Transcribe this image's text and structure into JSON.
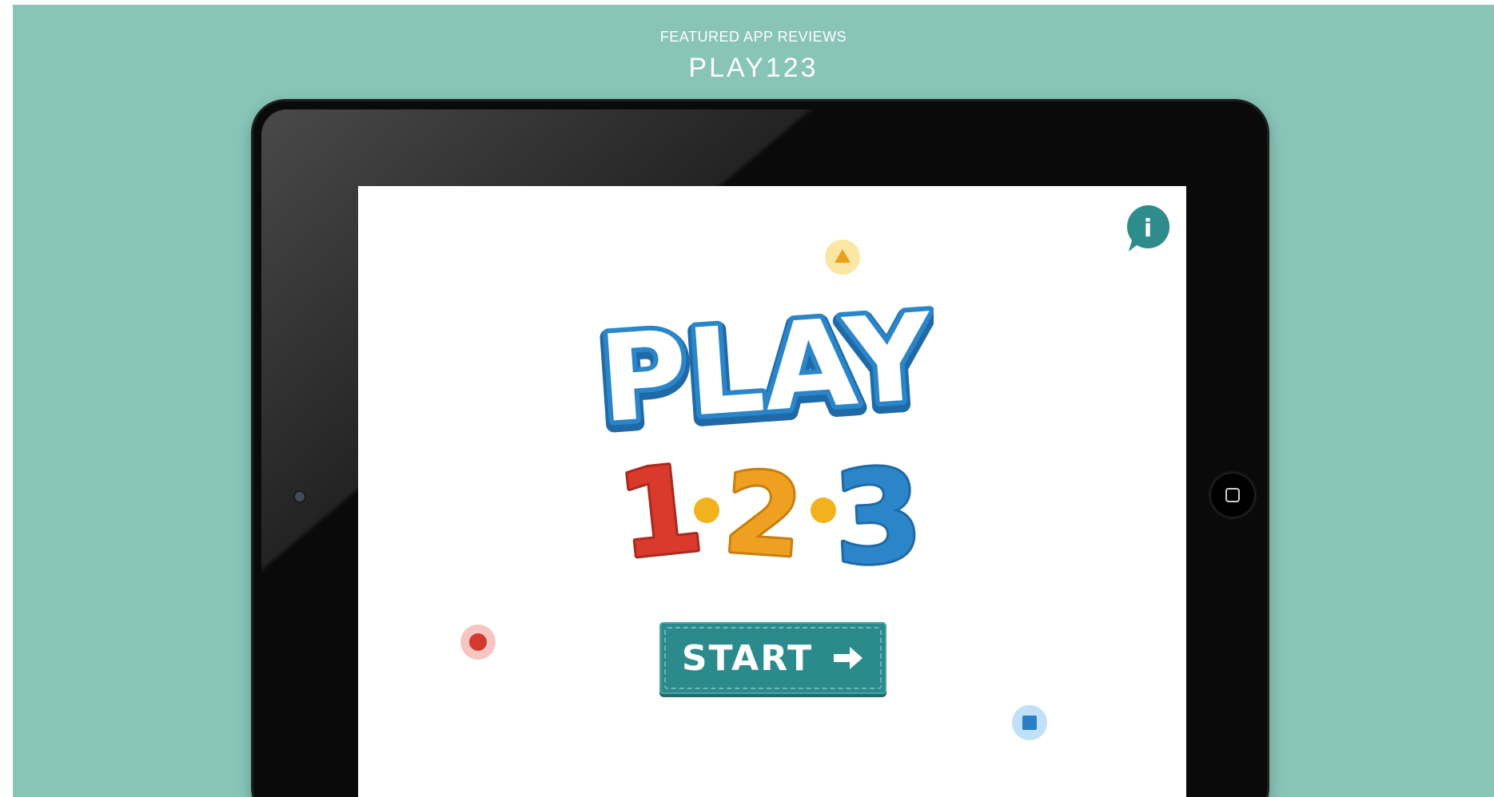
{
  "page": {
    "eyebrow": "FEATURED APP REVIEWS",
    "title": "PLAY123"
  },
  "app": {
    "logo": {
      "word": "PLAY",
      "numbers": [
        "1",
        "2",
        "3"
      ],
      "separator": "•"
    },
    "start_button": {
      "label": "START",
      "icon": "arrow-right-icon"
    },
    "info_button": {
      "label": "i",
      "icon": "info-speech-bubble-icon"
    },
    "decorations": [
      "yellow-triangle-icon",
      "red-circle-icon",
      "blue-square-icon"
    ]
  },
  "colors": {
    "background": "#88c4b8",
    "device_bezel": "#0a0a0a",
    "logo_blue": "#2b85c9",
    "number_red": "#d93a2b",
    "number_orange": "#f0a020",
    "number_blue": "#2b85c9",
    "start_teal": "#2a8a8c",
    "info_teal": "#2f8c8c"
  }
}
